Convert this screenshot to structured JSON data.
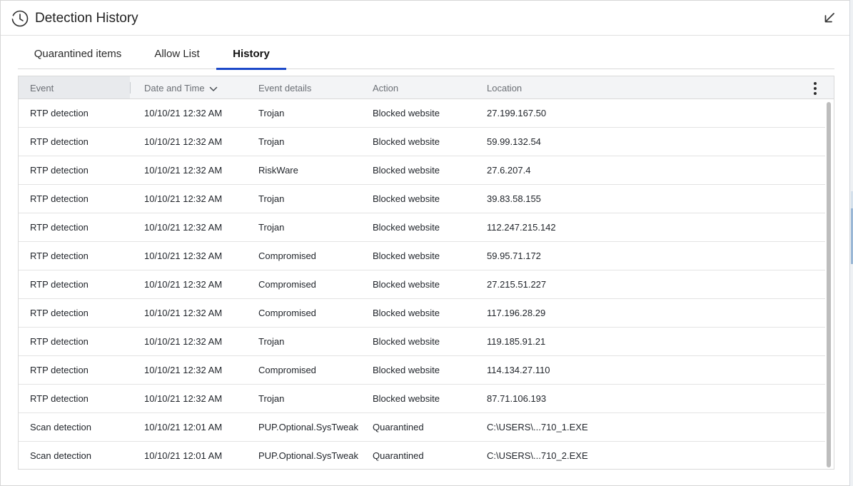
{
  "window": {
    "title": "Detection History"
  },
  "icons": {
    "title_icon": "history-clock-icon",
    "collapse": "arrow-down-left-icon",
    "more": "more-vertical-icon",
    "sort": "chevron-down-icon"
  },
  "tabs": [
    {
      "label": "Quarantined items",
      "active": false
    },
    {
      "label": "Allow List",
      "active": false
    },
    {
      "label": "History",
      "active": true
    }
  ],
  "table": {
    "columns": [
      "Event",
      "Date and Time",
      "Event details",
      "Action",
      "Location"
    ],
    "sort_column": "Date and Time",
    "rows": [
      {
        "event": "RTP detection",
        "date": "10/10/21 12:32 AM",
        "details": "Trojan",
        "action": "Blocked website",
        "location": "27.199.167.50"
      },
      {
        "event": "RTP detection",
        "date": "10/10/21 12:32 AM",
        "details": "Trojan",
        "action": "Blocked website",
        "location": "59.99.132.54"
      },
      {
        "event": "RTP detection",
        "date": "10/10/21 12:32 AM",
        "details": "RiskWare",
        "action": "Blocked website",
        "location": "27.6.207.4"
      },
      {
        "event": "RTP detection",
        "date": "10/10/21 12:32 AM",
        "details": "Trojan",
        "action": "Blocked website",
        "location": "39.83.58.155"
      },
      {
        "event": "RTP detection",
        "date": "10/10/21 12:32 AM",
        "details": "Trojan",
        "action": "Blocked website",
        "location": "112.247.215.142"
      },
      {
        "event": "RTP detection",
        "date": "10/10/21 12:32 AM",
        "details": "Compromised",
        "action": "Blocked website",
        "location": "59.95.71.172"
      },
      {
        "event": "RTP detection",
        "date": "10/10/21 12:32 AM",
        "details": "Compromised",
        "action": "Blocked website",
        "location": "27.215.51.227"
      },
      {
        "event": "RTP detection",
        "date": "10/10/21 12:32 AM",
        "details": "Compromised",
        "action": "Blocked website",
        "location": "117.196.28.29"
      },
      {
        "event": "RTP detection",
        "date": "10/10/21 12:32 AM",
        "details": "Trojan",
        "action": "Blocked website",
        "location": "119.185.91.21"
      },
      {
        "event": "RTP detection",
        "date": "10/10/21 12:32 AM",
        "details": "Compromised",
        "action": "Blocked website",
        "location": "114.134.27.110"
      },
      {
        "event": "RTP detection",
        "date": "10/10/21 12:32 AM",
        "details": "Trojan",
        "action": "Blocked website",
        "location": "87.71.106.193"
      },
      {
        "event": "Scan detection",
        "date": "10/10/21 12:01 AM",
        "details": "PUP.Optional.SysTweak",
        "action": "Quarantined",
        "location": "C:\\USERS\\...710_1.EXE"
      },
      {
        "event": "Scan detection",
        "date": "10/10/21 12:01 AM",
        "details": "PUP.Optional.SysTweak",
        "action": "Quarantined",
        "location": "C:\\USERS\\...710_2.EXE"
      }
    ]
  },
  "colors": {
    "accent": "#1c49c9",
    "header_bg": "#f3f4f6",
    "border": "#d9d9d9",
    "scrollbar": "#bdbdbd"
  }
}
